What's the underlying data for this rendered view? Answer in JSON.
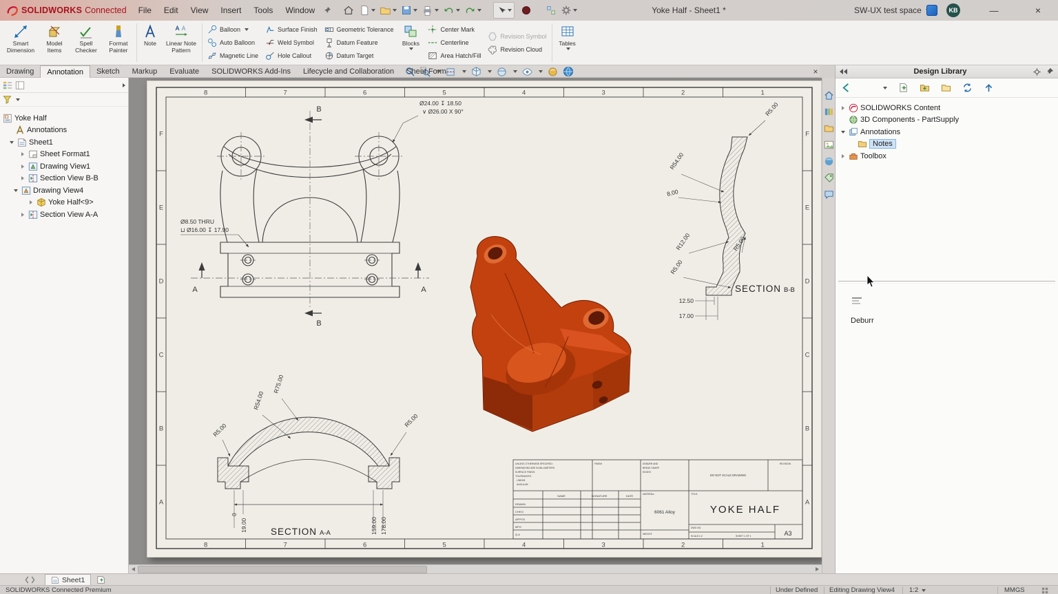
{
  "titlebar": {
    "logo_brand": "SOLIDWORKS",
    "logo_suffix": "Connected",
    "menus": [
      "File",
      "Edit",
      "View",
      "Insert",
      "Tools",
      "Window"
    ],
    "doc_title": "Yoke Half - Sheet1 *",
    "workspace": "SW-UX test space",
    "avatar": "KB",
    "minimize": "—",
    "close": "×"
  },
  "ribbon": {
    "smart_dimension": "Smart Dimension",
    "model_items": "Model Items",
    "spell_checker": "Spell Checker",
    "format_painter": "Format Painter",
    "note": "Note",
    "linear_note_pattern": "Linear Note Pattern",
    "balloon": "Balloon",
    "auto_balloon": "Auto Balloon",
    "magnetic_line": "Magnetic Line",
    "surface_finish": "Surface Finish",
    "weld_symbol": "Weld Symbol",
    "hole_callout": "Hole Callout",
    "geometric_tolerance": "Geometric Tolerance",
    "datum_feature": "Datum Feature",
    "datum_target": "Datum Target",
    "blocks": "Blocks",
    "center_mark": "Center Mark",
    "centerline": "Centerline",
    "area_hatch": "Area Hatch/Fill",
    "revision_symbol": "Revision Symbol",
    "revision_cloud": "Revision Cloud",
    "tables": "Tables"
  },
  "tabs": {
    "items": [
      "Drawing",
      "Annotation",
      "Sketch",
      "Markup",
      "Evaluate",
      "SOLIDWORKS Add-Ins",
      "Lifecycle and Collaboration",
      "Sheet Format"
    ],
    "active": "Annotation"
  },
  "feature_tree": {
    "root": "Yoke Half",
    "annotations": "Annotations",
    "sheet": "Sheet1",
    "children": [
      "Sheet Format1",
      "Drawing View1",
      "Section View B-B",
      "Drawing View4",
      "Yoke Half<9>",
      "Section View A-A"
    ]
  },
  "design_library": {
    "title": "Design Library",
    "items": [
      "SOLIDWORKS Content",
      "3D Components - PartSupply",
      "Annotations",
      "Notes",
      "Toolbox"
    ],
    "preview_label": "Deburr"
  },
  "sheet": {
    "zone_numbers": [
      "8",
      "7",
      "6",
      "5",
      "4",
      "3",
      "2",
      "1"
    ],
    "zone_letters": [
      "F",
      "E",
      "D",
      "C",
      "B",
      "A"
    ]
  },
  "front_view": {
    "dim1": "Ø24.00 ↧ 18.50",
    "dim2": "∨ Ø26.00 X 90°",
    "dim3": "Ø8.50 THRU",
    "dim4": "⊔ Ø16.00 ↧ 17.90",
    "label_a": "A",
    "label_b": "B"
  },
  "section_bb": {
    "title": "SECTION",
    "suffix": "B-B",
    "dims": [
      "R5.00",
      "R54.00",
      "8.00",
      "R12.00",
      "R5.00",
      "R5.00",
      "12.50",
      "17.00"
    ]
  },
  "section_aa": {
    "title": "SECTION",
    "suffix": "A-A",
    "dims": [
      "R75.00",
      "R54.00",
      "R5.00",
      "R5.00",
      "0",
      "19.00",
      "159.00",
      "178.00"
    ]
  },
  "title_block": {
    "notes": [
      "UNLESS OTHERWISE SPECIFIED:",
      "DIMENSIONS ARE IN MILLIMETERS",
      "SURFACE FINISH:",
      "TOLERANCES:",
      "LINEAR:",
      "ANGULAR:"
    ],
    "finish_label": "FINISH",
    "deburr_lines": [
      "DEBURR AND",
      "BREAK SHARP",
      "EDGES"
    ],
    "do_not_scale": "DO NOT SCALE DRAWING",
    "revision": "REVISION",
    "cols": [
      "NAME",
      "SIGNATURE",
      "DATE"
    ],
    "rows": [
      "DRAWN",
      "CHK'D",
      "APPV'D",
      "MFG",
      "Q.A"
    ],
    "title_label": "TITLE:",
    "part_title": "YOKE HALF",
    "material_label": "MATERIAL:",
    "material": "6061 Alloy",
    "weight_label": "WEIGHT:",
    "dwg_label": "DWG NO.",
    "size": "A3",
    "scale": "SCALE:1:2",
    "sheet_info": "SHEET 1 OF 1"
  },
  "sheet_tab": {
    "label": "Sheet1"
  },
  "status_bar": {
    "left": "SOLIDWORKS Connected Premium",
    "defined": "Under Defined",
    "editing": "Editing Drawing View4",
    "scale": "1:2",
    "units": "MMGS"
  }
}
